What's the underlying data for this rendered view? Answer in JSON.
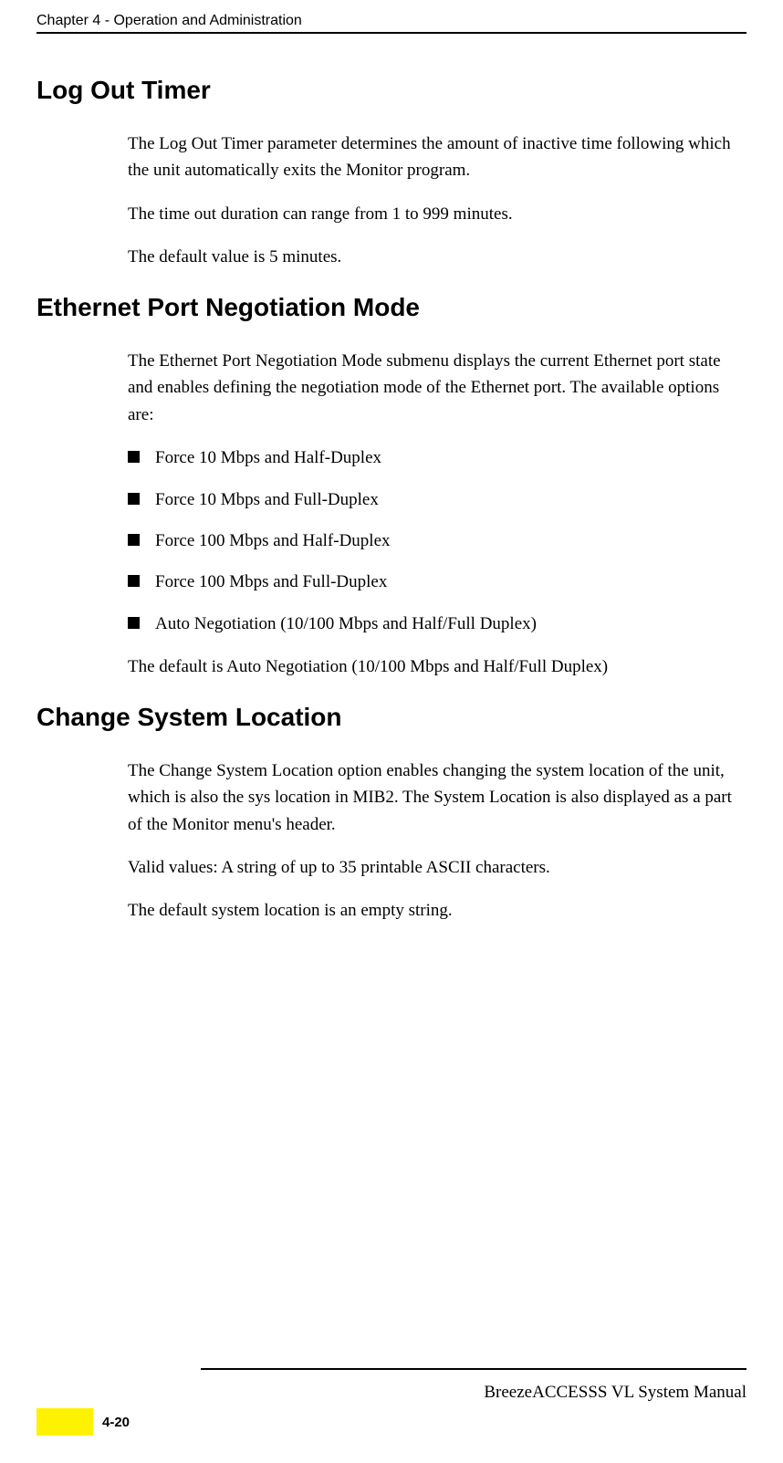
{
  "header": {
    "chapter": "Chapter 4 - Operation and Administration"
  },
  "sections": {
    "s1": {
      "title": "Log Out Timer",
      "p1": "The Log Out Timer parameter determines the amount of inactive time following which the unit automatically exits the Monitor program.",
      "p2": "The time out duration can range from 1 to 999 minutes.",
      "p3": "The default value is 5 minutes."
    },
    "s2": {
      "title": "Ethernet Port Negotiation Mode",
      "p1": "The Ethernet Port Negotiation Mode submenu displays the current Ethernet port state and enables defining the negotiation mode of the Ethernet port. The available options are:",
      "b1": "Force 10 Mbps and Half-Duplex",
      "b2": "Force 10 Mbps and Full-Duplex",
      "b3": "Force 100 Mbps and Half-Duplex",
      "b4": "Force 100 Mbps and Full-Duplex",
      "b5": "Auto Negotiation (10/100 Mbps and Half/Full Duplex)",
      "p2": "The default is Auto Negotiation (10/100 Mbps and Half/Full Duplex)"
    },
    "s3": {
      "title": "Change System Location",
      "p1": "The Change System Location option enables changing the system location of the unit, which is also the sys location in MIB2. The System Location is also displayed as a part of the Monitor menu's header.",
      "p2": "Valid values: A string of up to 35 printable ASCII characters.",
      "p3": "The default system location is an empty string."
    }
  },
  "footer": {
    "doc_title": "BreezeACCESSS VL System Manual",
    "page": "4-20"
  }
}
